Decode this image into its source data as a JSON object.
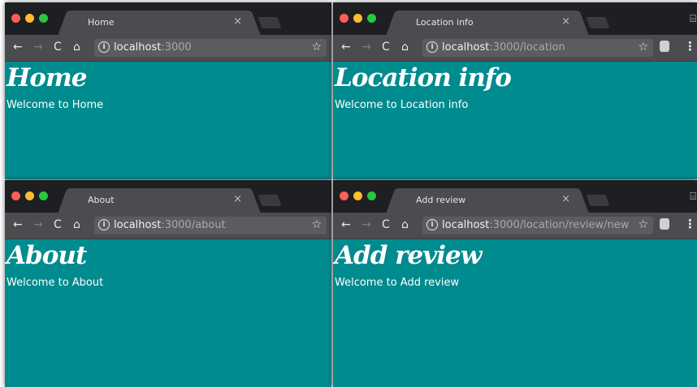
{
  "windows": {
    "home": {
      "tab_title": "Home",
      "url_host": "localhost",
      "url_path": ":3000",
      "heading": "Home",
      "welcome": "Welcome to Home"
    },
    "location": {
      "tab_title": "Location info",
      "url_host": "localhost",
      "url_path": ":3000/location",
      "heading": "Location info",
      "welcome": "Welcome to Location info"
    },
    "about": {
      "tab_title": "About",
      "url_host": "localhost",
      "url_path": ":3000/about",
      "heading": "About",
      "welcome": "Welcome to About"
    },
    "review": {
      "tab_title": "Add review",
      "url_host": "localhost",
      "url_path": ":3000/location/review/new",
      "heading": "Add review",
      "welcome": "Welcome to Add review"
    }
  },
  "icons": {
    "back": "←",
    "forward": "→",
    "reload": "C",
    "home": "⌂",
    "info": "i",
    "star": "☆",
    "close": "×",
    "menu": "⋮",
    "cast": "⌸"
  },
  "colors": {
    "page_background": "#008b8f",
    "titlebar": "#1e1f22",
    "toolbar": "#4b4c4f",
    "traffic_red": "#ff5f57",
    "traffic_yellow": "#febc2e",
    "traffic_green": "#28c840"
  }
}
